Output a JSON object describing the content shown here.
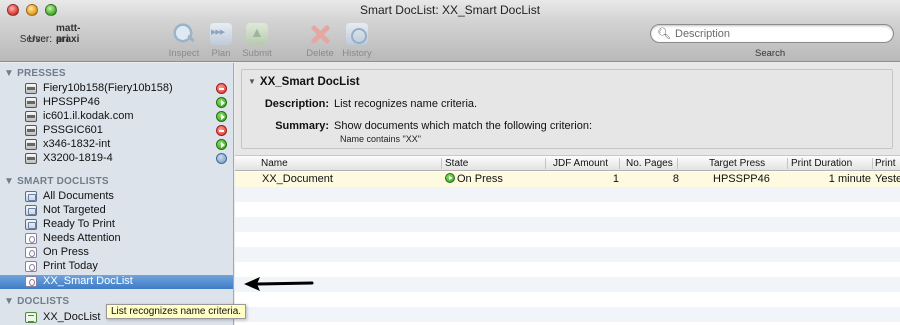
{
  "window": {
    "title": "Smart DocList: XX_Smart DocList"
  },
  "toolbar": {
    "server_label": "Server:",
    "server_value": "matt-pri",
    "user_label": "User:",
    "user_value": "araxi",
    "buttons": [
      "Inspect",
      "Plan",
      "Submit",
      "Delete",
      "History"
    ]
  },
  "search": {
    "placeholder": "Description",
    "caption": "Search"
  },
  "sidebar": {
    "presses_header": "PRESSES",
    "presses": [
      {
        "label": "Fiery10b158(Fiery10b158)",
        "status": "stopped"
      },
      {
        "label": "HPSSPP46",
        "status": "running"
      },
      {
        "label": "ic601.il.kodak.com",
        "status": "running"
      },
      {
        "label": "PSSGIC601",
        "status": "stopped"
      },
      {
        "label": "x346-1832-int",
        "status": "running"
      },
      {
        "label": "X3200-1819-4",
        "status": "network"
      }
    ],
    "smart_header": "SMART DOCLISTS",
    "smart": [
      {
        "label": "All Documents"
      },
      {
        "label": "Not Targeted"
      },
      {
        "label": "Ready To Print"
      },
      {
        "label": "Needs Attention"
      },
      {
        "label": "On Press"
      },
      {
        "label": "Print Today"
      },
      {
        "label": "XX_Smart DocList",
        "selected": true
      }
    ],
    "doclists_header": "DOCLISTS",
    "doclists": [
      {
        "label": "XX_DocList"
      }
    ]
  },
  "info": {
    "title": "XX_Smart DocList",
    "description_label": "Description:",
    "description_value": "List recognizes name criteria.",
    "summary_label": "Summary:",
    "summary_value": "Show documents which match the following criterion:",
    "criterion": "Name contains \"XX\""
  },
  "table": {
    "columns": [
      "Name",
      "State",
      "JDF Amount",
      "No. Pages",
      "Target Press",
      "Print Duration",
      "Print"
    ],
    "rows": [
      {
        "name": "XX_Document",
        "state": "On Press",
        "jdf_amount": "1",
        "pages": "8",
        "target_press": "HPSSPP46",
        "duration": "1 minute",
        "print_date": "Yeste"
      }
    ]
  },
  "tooltip": {
    "text": "List recognizes name criteria."
  },
  "colors": {
    "selection": "#3f7cc6",
    "sidebar_bg": "#dde3ea",
    "row_highlight": "#fdfadf",
    "tooltip_bg": "#ffffc6"
  }
}
